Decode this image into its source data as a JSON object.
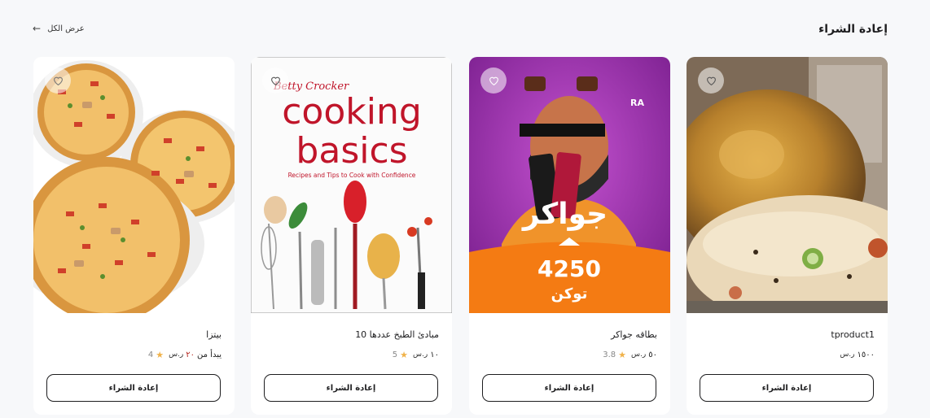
{
  "header": {
    "title": "إعادة الشراء",
    "view_all": "عرض الكل"
  },
  "cards": [
    {
      "name": "tproduct1",
      "price": "١٥٠٠",
      "currency": "ر.س",
      "button": "إعادة الشراء"
    },
    {
      "name": "بطاقه جواكر",
      "price": "٥٠",
      "currency": "ر.س",
      "rating": "3.8",
      "button": "إعادة الشراء",
      "image": {
        "big": "جواكر",
        "tokens": "4250",
        "tokens_label": "توكن",
        "brand": "RA"
      }
    },
    {
      "name": "مبادئ الطبخ عددها 10",
      "price": "١٠",
      "currency": "ر.س",
      "rating": "5",
      "button": "إعادة الشراء",
      "image": {
        "brand": "Betty Crocker",
        "line1": "cooking",
        "line2": "basics",
        "sub": "Recipes and Tips to Cook with Confidence"
      }
    },
    {
      "name": "بيتزا",
      "price_prefix": "يبدأ من",
      "price": "٢٠",
      "currency": "ر.س",
      "rating": "4",
      "button": "إعادة الشراء"
    }
  ],
  "colors": {
    "accent_purple": "#8a2ea0",
    "accent_orange": "#f47b13",
    "star": "#f0b24a",
    "price_red": "#b4261e"
  },
  "icons": {
    "favorite": "heart-icon",
    "view_all": "arrow-left-icon",
    "rating": "star-icon",
    "currency": "riyal-icon"
  }
}
